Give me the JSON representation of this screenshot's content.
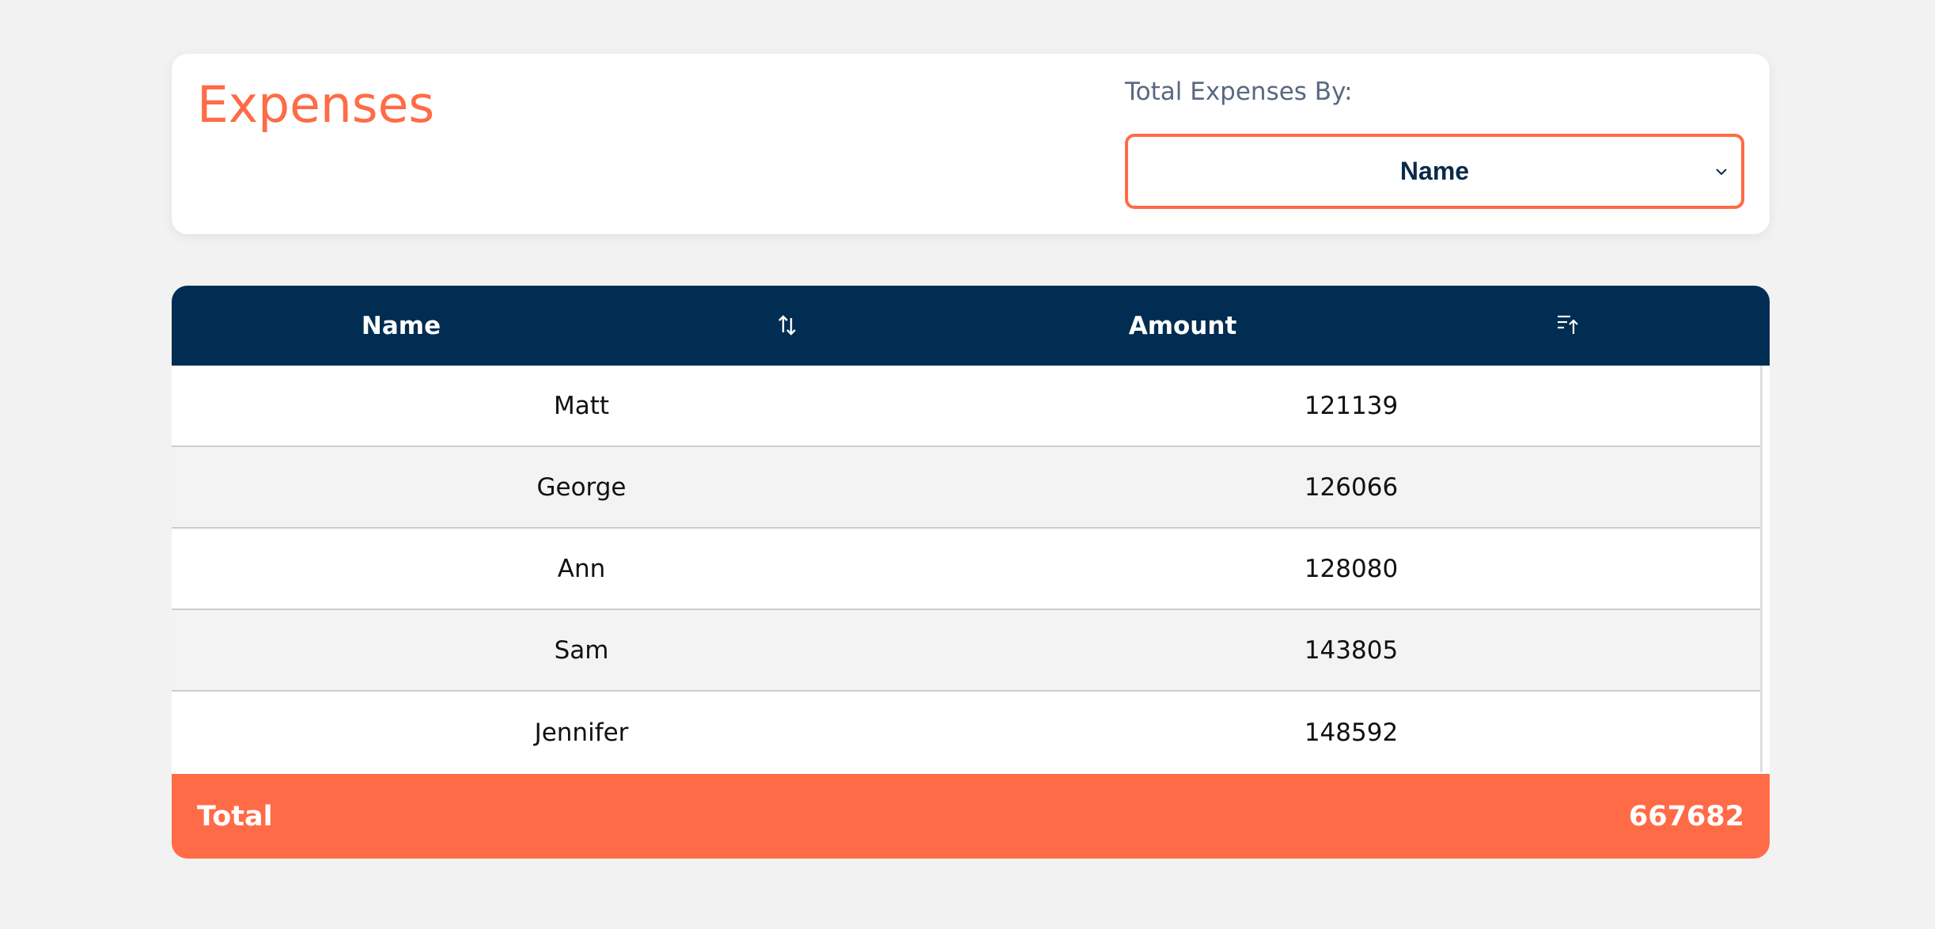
{
  "header": {
    "title": "Expenses",
    "filter_label": "Total Expenses By:",
    "selected_group": "Name"
  },
  "table": {
    "columns": [
      {
        "label": "Name",
        "sort_icon": "sort-arrows-icon"
      },
      {
        "label": "Amount",
        "sort_icon": "sort-ascending-icon"
      }
    ],
    "rows": [
      {
        "name": "Matt",
        "amount": "121139"
      },
      {
        "name": "George",
        "amount": "126066"
      },
      {
        "name": "Ann",
        "amount": "128080"
      },
      {
        "name": "Sam",
        "amount": "143805"
      },
      {
        "name": "Jennifer",
        "amount": "148592"
      }
    ],
    "footer": {
      "label": "Total",
      "value": "667682"
    }
  },
  "colors": {
    "accent": "#ff6b47",
    "header_bg": "#002d51",
    "page_bg": "#f1f2f1"
  }
}
